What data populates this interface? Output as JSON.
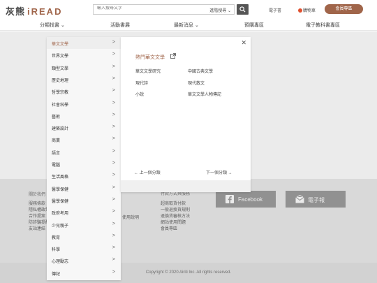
{
  "header": {
    "logo_cn": "灰熊",
    "logo_en": "iREAD",
    "search_placeholder": "輸入搜尋文字",
    "adv_search": "進階搜尋 ⌄",
    "ebook": "電子書",
    "notice": "購物車",
    "member": "會員專區"
  },
  "nav": {
    "items": [
      "分類找書 ⌄",
      "活動書展",
      "最新消息 ⌄",
      "預購專區",
      "電子教科書專區"
    ]
  },
  "categories": [
    "華文文學",
    "世界文學",
    "類型文學",
    "歷史地理",
    "哲學宗教",
    "社會科學",
    "藝術",
    "建築設計",
    "商業",
    "語言",
    "電腦",
    "生活風格",
    "醫學保健",
    "醫學保健",
    "政府考用",
    "少兒親子",
    "教育",
    "科學",
    "心理勵志",
    "傳記"
  ],
  "submenu": {
    "title": "熱門華文文學",
    "links": [
      "華文文學研究",
      "中國古典文學",
      "現代詩",
      "現代散文",
      "小說",
      "華文文學人物傳記"
    ],
    "prev": "←  上一個分類",
    "next": "下一個分類  →"
  },
  "footer": {
    "col1_title": "關於我們",
    "col1_links": [
      "服務條款",
      "隱私權政策",
      "合作提案",
      "防詐騙提醒",
      "友站連結"
    ],
    "col2_fragment": "使用說明",
    "col3_title": "付款方式與服務",
    "col3_links": [
      "超商取貨付款",
      "一般退換貨規則",
      "退換貨審核方法",
      "網站使用問題",
      "會員專區"
    ],
    "facebook": "Facebook",
    "ebook_label": "電子報",
    "copyright": "Copyright © 2020 Airiti Inc. All rights reserved."
  },
  "colors": {
    "accent": "#a0654a",
    "dark": "#555555"
  }
}
